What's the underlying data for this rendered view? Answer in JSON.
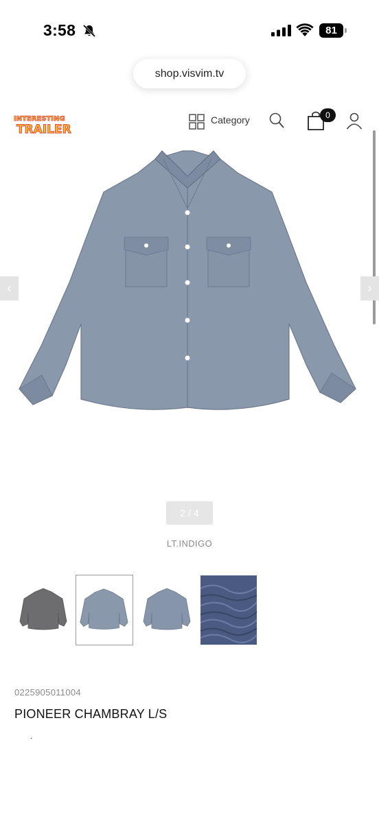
{
  "status_bar": {
    "time": "3:58",
    "battery": "81",
    "icons": [
      "bell-muted-icon",
      "signal-icon",
      "wifi-icon",
      "battery-icon"
    ]
  },
  "browser": {
    "url": "shop.visvim.tv"
  },
  "header": {
    "logo_text": "INTERESTING TRAILER",
    "category_label": "Category",
    "cart_count": "0",
    "icons": [
      "category-grid-icon",
      "search-icon",
      "cart-icon",
      "user-icon"
    ]
  },
  "gallery": {
    "pager": "2 / 4",
    "color_name": "LT.INDIGO",
    "prev_icon": "chevron-left-icon",
    "next_icon": "chevron-right-icon",
    "thumbnails": [
      "charcoal shirt",
      "light indigo shirt",
      "light indigo shirt back",
      "fabric detail"
    ],
    "selected_thumbnail": 2
  },
  "product": {
    "code": "0225905011004",
    "name": "PIONEER CHAMBRAY L/S",
    "dot": "."
  },
  "colors": {
    "shirt": "#8a98ac",
    "thumb_dark": "#6d6d6f",
    "fabric": "#4a5a80",
    "logo_red": "#e24a3b",
    "logo_yellow": "#f2c12e"
  }
}
